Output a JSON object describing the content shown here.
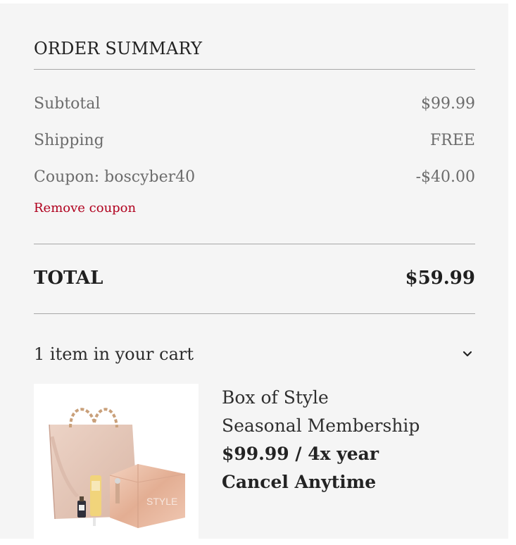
{
  "summary": {
    "title": "ORDER SUMMARY",
    "subtotal_label": "Subtotal",
    "subtotal_value": "$99.99",
    "shipping_label": "Shipping",
    "shipping_value": "FREE",
    "coupon_label": "Coupon: boscyber40",
    "coupon_value": "-$40.00",
    "remove_coupon": "Remove coupon",
    "total_label": "TOTAL",
    "total_value": "$59.99"
  },
  "cart": {
    "count_text": "1 item in your cart",
    "toggle_icon": "chevron-down-icon",
    "item": {
      "name_line1": "Box of Style",
      "name_line2": "Seasonal Membership",
      "price_line": "$99.99 / 4x year",
      "cancel_line": "Cancel Anytime",
      "image_subject": "product-photo-tote-bag-and-box",
      "image_box_text": "STYLE"
    }
  },
  "colors": {
    "panel_background": "#f5f5f5",
    "remove_link": "#b0001e",
    "divider": "#a7a7a7",
    "muted_text": "#6c6c6c"
  }
}
